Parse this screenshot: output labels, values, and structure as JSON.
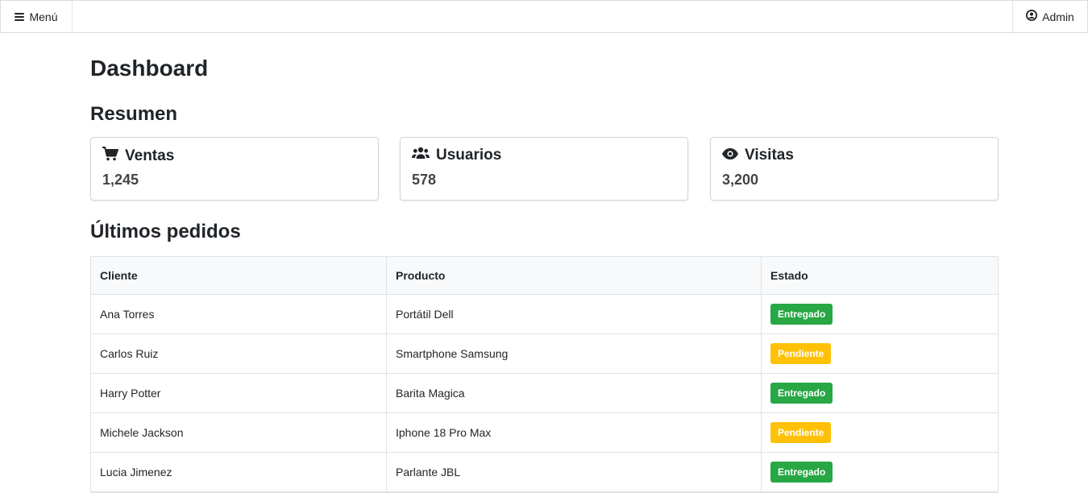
{
  "topbar": {
    "menu_label": "Menú",
    "user_label": "Admin"
  },
  "page": {
    "title": "Dashboard",
    "summary_title": "Resumen",
    "orders_title": "Últimos pedidos"
  },
  "cards": [
    {
      "label": "Ventas",
      "value": "1,245",
      "icon": "cart-icon"
    },
    {
      "label": "Usuarios",
      "value": "578",
      "icon": "users-icon"
    },
    {
      "label": "Visitas",
      "value": "3,200",
      "icon": "eye-icon"
    }
  ],
  "orders": {
    "headers": [
      "Cliente",
      "Producto",
      "Estado"
    ],
    "rows": [
      {
        "cliente": "Ana Torres",
        "producto": "Portátil Dell",
        "estado": "Entregado"
      },
      {
        "cliente": "Carlos Ruiz",
        "producto": "Smartphone Samsung",
        "estado": "Pendiente"
      },
      {
        "cliente": "Harry Potter",
        "producto": "Barita Magica",
        "estado": "Entregado"
      },
      {
        "cliente": "Michele Jackson",
        "producto": "Iphone 18 Pro Max",
        "estado": "Pendiente"
      },
      {
        "cliente": "Lucia Jimenez",
        "producto": "Parlante JBL",
        "estado": "Entregado"
      }
    ]
  },
  "colors": {
    "entregado": "#28a745",
    "pendiente": "#ffc107"
  }
}
